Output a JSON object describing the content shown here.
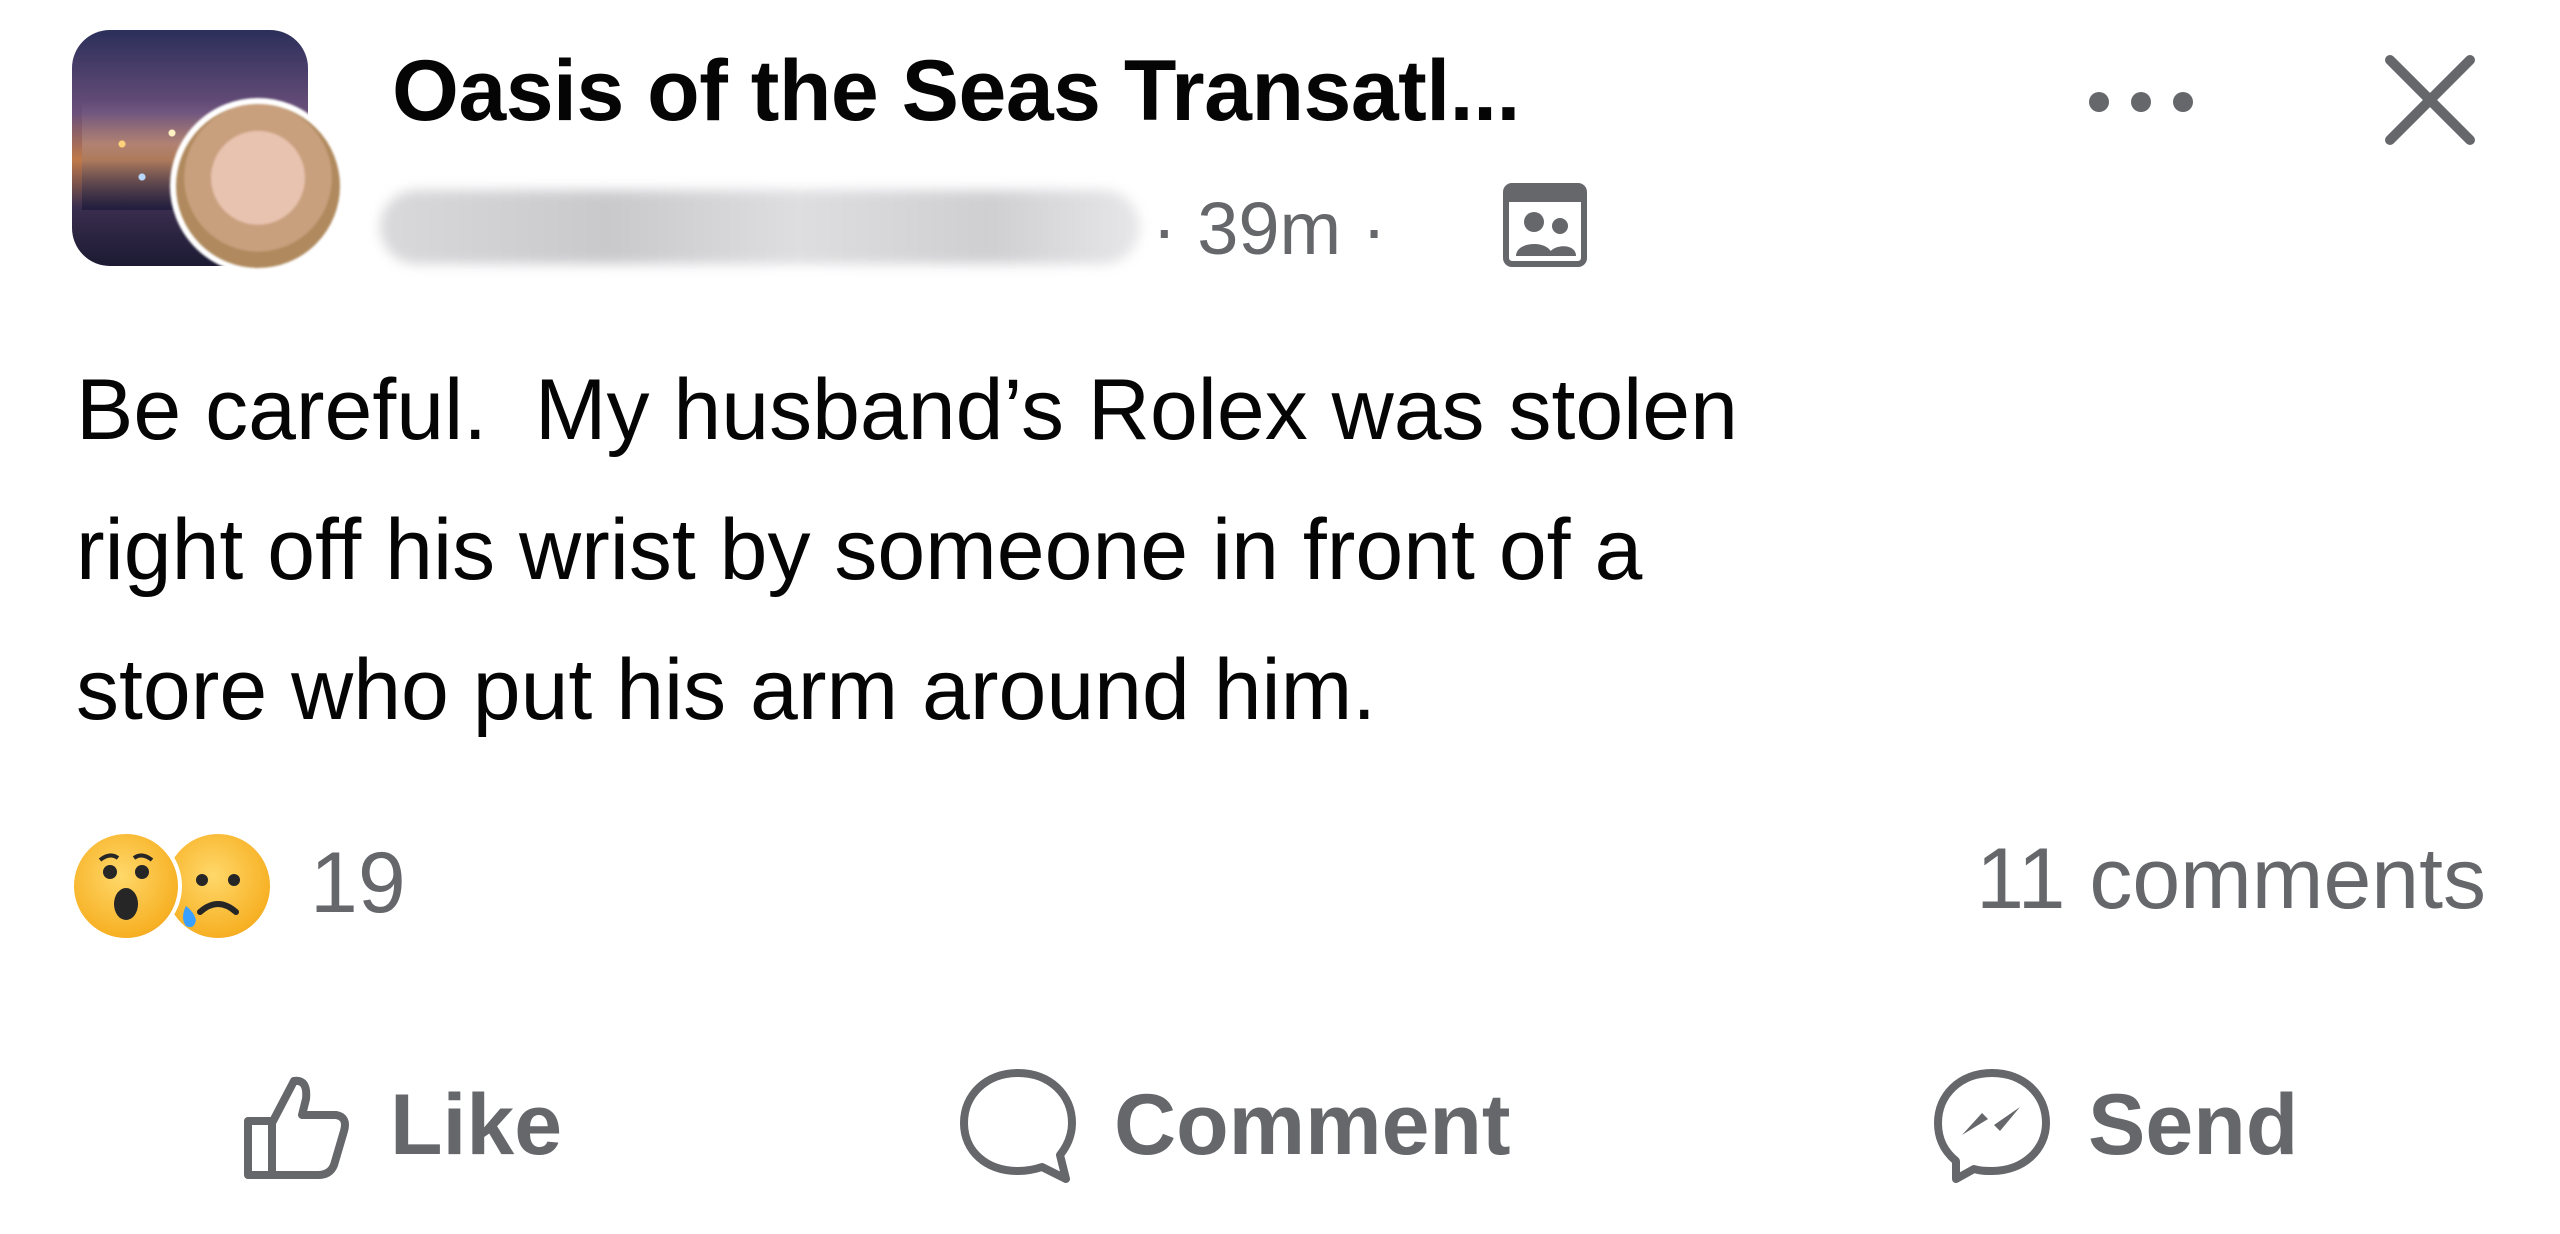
{
  "post": {
    "group_name": "Oasis of the Seas Transatl...",
    "timestamp": "39m",
    "separator": "·",
    "audience_icon": "group-members-icon",
    "body": "Be careful.  My husband’s Rolex was stolen\nright off his wrist by someone in front of a\nstore who put his arm around him."
  },
  "reactions": {
    "types": [
      "wow",
      "sad"
    ],
    "count": "19"
  },
  "comments": {
    "label": "11 comments"
  },
  "actions": {
    "like_label": "Like",
    "comment_label": "Comment",
    "send_label": "Send"
  },
  "colors": {
    "primary_text": "#050505",
    "secondary_text": "#65676b",
    "background": "#ffffff",
    "reaction_yellow": "#f7b125"
  }
}
